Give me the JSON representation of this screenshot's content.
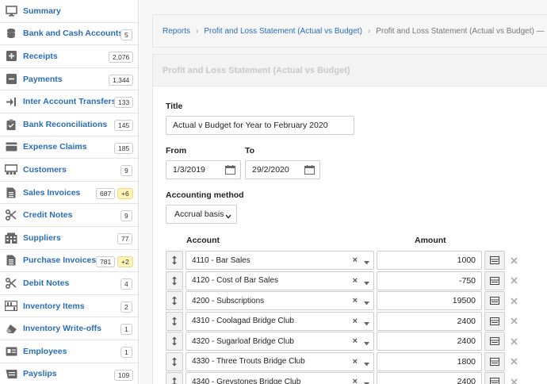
{
  "sidebar": {
    "items": [
      {
        "label": "Summary",
        "icon": "monitor-icon",
        "badge": "",
        "extra": ""
      },
      {
        "label": "Bank and Cash Accounts",
        "icon": "coins-icon",
        "badge": "5",
        "extra": ""
      },
      {
        "label": "Receipts",
        "icon": "plus-square-icon",
        "badge": "2,076",
        "extra": ""
      },
      {
        "label": "Payments",
        "icon": "minus-square-icon",
        "badge": "1,344",
        "extra": ""
      },
      {
        "label": "Inter Account Transfers",
        "icon": "transfer-icon",
        "badge": "133",
        "extra": ""
      },
      {
        "label": "Bank Reconciliations",
        "icon": "clipboard-icon",
        "badge": "145",
        "extra": ""
      },
      {
        "label": "Expense Claims",
        "icon": "card-icon",
        "badge": "185",
        "extra": ""
      },
      {
        "label": "Customers",
        "icon": "customers-icon",
        "badge": "9",
        "extra": ""
      },
      {
        "label": "Sales Invoices",
        "icon": "document-icon",
        "badge": "687",
        "extra": "+6"
      },
      {
        "label": "Credit Notes",
        "icon": "scissors-icon",
        "badge": "9",
        "extra": ""
      },
      {
        "label": "Suppliers",
        "icon": "building-icon",
        "badge": "77",
        "extra": ""
      },
      {
        "label": "Purchase Invoices",
        "icon": "document-icon",
        "badge": "781",
        "extra": "+2"
      },
      {
        "label": "Debit Notes",
        "icon": "scissors-icon",
        "badge": "4",
        "extra": ""
      },
      {
        "label": "Inventory Items",
        "icon": "inventory-icon",
        "badge": "2",
        "extra": ""
      },
      {
        "label": "Inventory Write-offs",
        "icon": "eraser-icon",
        "badge": "1",
        "extra": ""
      },
      {
        "label": "Employees",
        "icon": "id-card-icon",
        "badge": "1",
        "extra": ""
      },
      {
        "label": "Payslips",
        "icon": "payslip-icon",
        "badge": "109",
        "extra": ""
      }
    ]
  },
  "breadcrumb": {
    "items": [
      "Reports",
      "Profit and Loss Statement (Actual vs Budget)"
    ],
    "current": "Profit and Loss Statement (Actual vs Budget) — Edi"
  },
  "panel": {
    "title": "Profit and Loss Statement (Actual vs Budget)"
  },
  "form": {
    "title_label": "Title",
    "title_value": "Actual v Budget for Year to February 2020",
    "from_label": "From",
    "from_value": "1/3/2019",
    "to_label": "To",
    "to_value": "29/2/2020",
    "method_label": "Accounting method",
    "method_value": "Accrual basis",
    "account_header": "Account",
    "amount_header": "Amount",
    "rows": [
      {
        "account": "4110 - Bar Sales",
        "amount": "1000"
      },
      {
        "account": "4120 - Cost of Bar Sales",
        "amount": "-750"
      },
      {
        "account": "4200 - Subscriptions",
        "amount": "19500"
      },
      {
        "account": "4310 - Coolagad Bridge Club",
        "amount": "2400"
      },
      {
        "account": "4320 - Sugarloaf Bridge Club",
        "amount": "2400"
      },
      {
        "account": "4330 - Three Trouts Bridge Club",
        "amount": "1800"
      },
      {
        "account": "4340 - Greystones Bridge Club",
        "amount": "2400"
      }
    ]
  },
  "colors": {
    "link": "#2a6db5",
    "badge_highlight": "#fcf3b5"
  }
}
